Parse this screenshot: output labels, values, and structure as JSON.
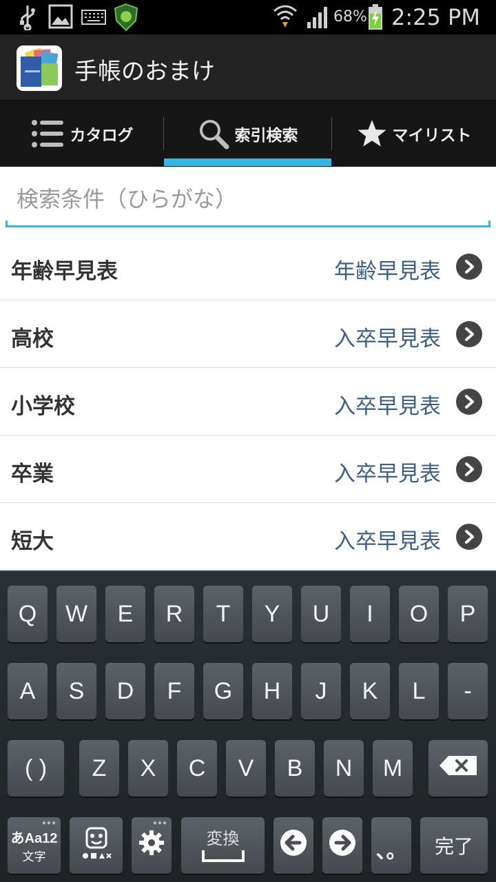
{
  "status_bar": {
    "battery_percent": "68%",
    "time": "2:25 PM"
  },
  "app": {
    "title": "手帳のおまけ"
  },
  "tabs": [
    {
      "label": "カタログ",
      "icon": "list-icon"
    },
    {
      "label": "索引検索",
      "icon": "search-icon",
      "selected": true
    },
    {
      "label": "マイリスト",
      "icon": "star-icon"
    }
  ],
  "search": {
    "placeholder": "検索条件（ひらがな）",
    "value": ""
  },
  "results": [
    {
      "label": "年齢早見表",
      "value": "年齢早見表"
    },
    {
      "label": "高校",
      "value": "入卒早見表"
    },
    {
      "label": "小学校",
      "value": "入卒早見表"
    },
    {
      "label": "卒業",
      "value": "入卒早見表"
    },
    {
      "label": "短大",
      "value": "入卒早見表"
    }
  ],
  "keyboard": {
    "row1": [
      "Q",
      "W",
      "E",
      "R",
      "T",
      "Y",
      "U",
      "I",
      "O",
      "P"
    ],
    "row2": [
      "A",
      "S",
      "D",
      "F",
      "G",
      "H",
      "J",
      "K",
      "L",
      "-"
    ],
    "row3": [
      "( )",
      "Z",
      "X",
      "C",
      "V",
      "B",
      "N",
      "M"
    ],
    "mode_key": {
      "top": "あAa12",
      "bottom": "文字"
    },
    "space_label": "変換",
    "done_label": "完了",
    "punct_label": "、。"
  },
  "colors": {
    "accent": "#33b5e5",
    "link_text": "#3a5e8c"
  }
}
